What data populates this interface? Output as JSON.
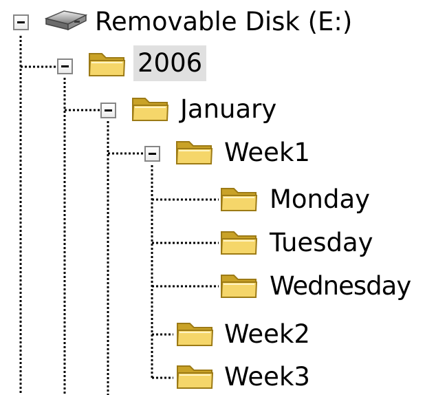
{
  "tree": {
    "nodes": [
      {
        "id": "drive",
        "label": "Removable Disk (E:)",
        "icon": "removable-drive-icon",
        "expander": "collapse"
      },
      {
        "id": "2006",
        "label": "2006",
        "icon": "folder-icon",
        "expander": "collapse",
        "selected": true
      },
      {
        "id": "january",
        "label": "January",
        "icon": "folder-icon",
        "expander": "collapse"
      },
      {
        "id": "week1",
        "label": "Week1",
        "icon": "folder-icon",
        "expander": "collapse"
      },
      {
        "id": "monday",
        "label": "Monday",
        "icon": "folder-icon"
      },
      {
        "id": "tuesday",
        "label": "Tuesday",
        "icon": "folder-icon"
      },
      {
        "id": "wednesday",
        "label": "Wednesday",
        "icon": "folder-icon"
      },
      {
        "id": "week2",
        "label": "Week2",
        "icon": "folder-icon"
      },
      {
        "id": "week3",
        "label": "Week3",
        "icon": "folder-icon"
      }
    ]
  },
  "colors": {
    "folder_fill": "#f5d66a",
    "folder_dark": "#c9a227",
    "selection_bg": "#e0e0e0",
    "guide_line": "#000000"
  }
}
